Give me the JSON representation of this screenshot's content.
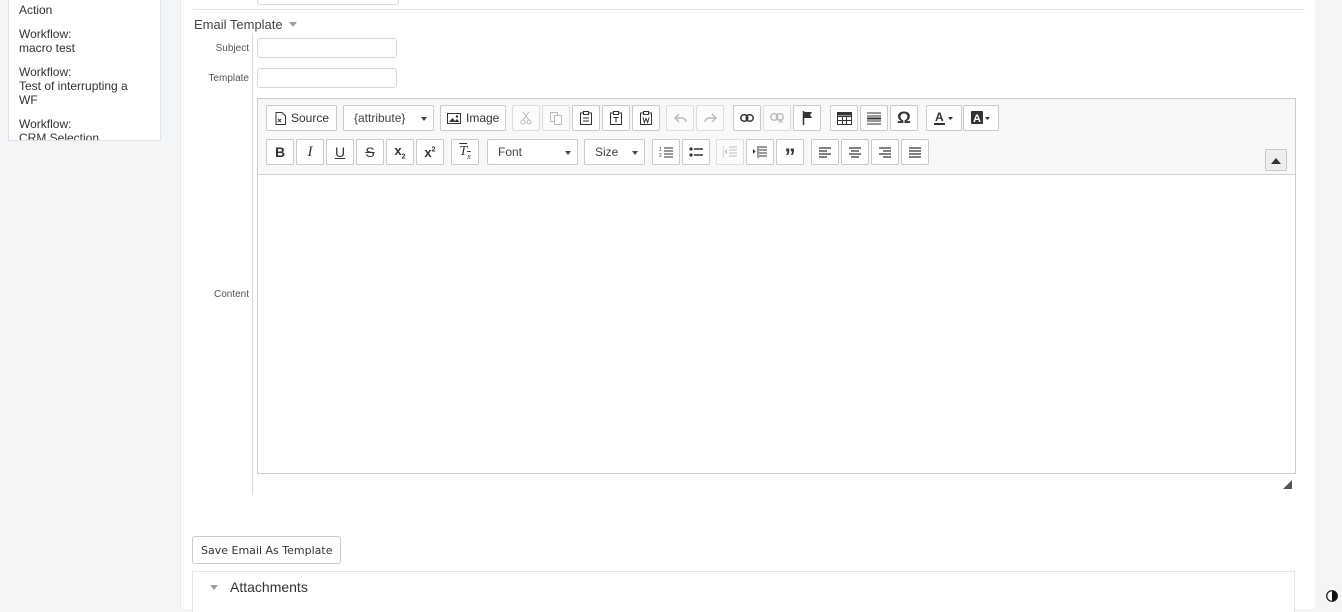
{
  "sidebar": {
    "items": [
      {
        "prefix": "",
        "name": "Action"
      },
      {
        "prefix": "Workflow:",
        "name": "macro test"
      },
      {
        "prefix": "Workflow:",
        "name": "Test of interrupting a WF"
      },
      {
        "prefix": "Workflow:",
        "name": "CRM Selection"
      }
    ]
  },
  "email_template": {
    "title": "Email Template",
    "subject_label": "Subject",
    "template_label": "Template",
    "content_label": "Content",
    "subject_value": "",
    "template_value": ""
  },
  "toolbar": {
    "source": "Source",
    "attribute": "{attribute}",
    "image": "Image",
    "font": "Font",
    "size": "Size"
  },
  "actions": {
    "save_as_template": "Save Email As Template"
  },
  "attachments": {
    "title": "Attachments"
  }
}
